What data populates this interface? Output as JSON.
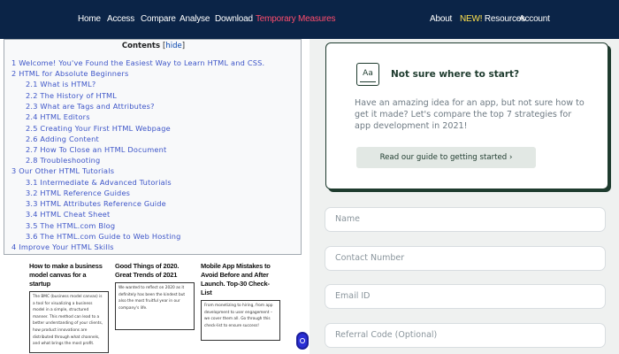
{
  "nav": {
    "left": [
      "Home",
      "Access",
      "Compare",
      "Analyse",
      "Download",
      "Temporary Measures"
    ],
    "right": {
      "about": "About",
      "new_badge": "NEW!",
      "resources": "Resources",
      "account": "Account"
    },
    "colors": {
      "background": "#0b2447",
      "highlight": "#ff4d6d",
      "badge": "#ffe14d"
    }
  },
  "toc": {
    "title": "Contents",
    "hide_label": "hide",
    "items": [
      "1 Welcome! You've Found the Easiest Way to Learn HTML and CSS.",
      "2 HTML for Absolute Beginners",
      "2.1 What is HTML?",
      "2.2 The History of HTML",
      "2.3 What are Tags and Attributes?",
      "2.4 HTML Editors",
      "2.5 Creating Your First HTML Webpage",
      "2.6 Adding Content",
      "2.7 How To Close an HTML Document",
      "2.8 Troubleshooting",
      "3 Our Other HTML Tutorials",
      "3.1 Intermediate & Advanced Tutorials",
      "3.2 HTML Reference Guides",
      "3.3 HTML Attributes Reference Guide",
      "3.4 HTML Cheat Sheet",
      "3.5 The HTML.com Blog",
      "3.6 The HTML.com Guide to Web Hosting",
      "4 Improve Your HTML Skills"
    ]
  },
  "cards": [
    {
      "title": "How to make a business model canvas for a startup",
      "body": "The BMC (business model canvas) is a tool for visualizing a business model in a simple, structured manner. This method can lead to a better understanding of your clients, how product innovations are distributed through what channels, and what brings the most profit."
    },
    {
      "title": "Good Things of 2020. Great Trends of 2021",
      "body": "We wanted to reflect on 2020 as it definitely has been the kindest but also the most fruitful year in our company's life."
    },
    {
      "title": "Mobile App Mistakes to Avoid Before and After Launch. Top-30 Check-List",
      "body": "From monetizing to hiring, from app development to user engagement – we cover them all. Go through this check-list to ensure success!"
    }
  ],
  "promo": {
    "icon_text": "Aa",
    "title": "Not sure where to start?",
    "text": "Have an amazing idea for an app, but not sure how to get it made? Let's compare the top 7 strategies for app development in 2021!",
    "button": "Read our guide to getting started ›"
  },
  "form": {
    "name_placeholder": "Name",
    "contact_placeholder": "Contact Number",
    "email_placeholder": "Email ID",
    "referral_placeholder": "Referral Code (Optional)"
  }
}
